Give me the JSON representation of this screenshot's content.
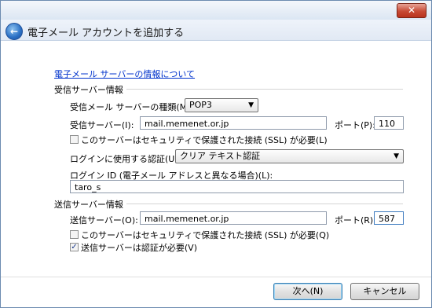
{
  "header": {
    "title": "電子メール アカウントを追加する"
  },
  "link": {
    "text": "電子メール サーバーの情報について"
  },
  "incoming": {
    "section_title": "受信サーバー情報",
    "server_type_label": "受信メール サーバーの種類(M):",
    "server_type_value": "POP3",
    "server_label": "受信サーバー(I):",
    "server_value": "mail.memenet.or.jp",
    "port_label": "ポート(P):",
    "port_value": "110",
    "ssl_label": "このサーバーはセキュリティで保護された接続 (SSL) が必要(L)",
    "ssl_checked": false,
    "auth_label": "ログインに使用する認証(U):",
    "auth_value": "クリア テキスト認証",
    "login_id_label": "ログイン ID (電子メール アドレスと異なる場合)(L):",
    "login_id_value": "taro_s"
  },
  "outgoing": {
    "section_title": "送信サーバー情報",
    "server_label": "送信サーバー(O):",
    "server_value": "mail.memenet.or.jp",
    "port_label": "ポート(R):",
    "port_value": "587",
    "ssl_label": "このサーバーはセキュリティで保護された接続 (SSL) が必要(Q)",
    "ssl_checked": false,
    "auth_required_label": "送信サーバーは認証が必要(V)",
    "auth_required_checked": true
  },
  "buttons": {
    "next": "次へ(N)",
    "cancel": "キャンセル"
  },
  "icons": {
    "close": "close-icon",
    "back": "back-arrow-icon",
    "dropdown": "chevron-down-icon",
    "check": "checkmark-icon"
  }
}
